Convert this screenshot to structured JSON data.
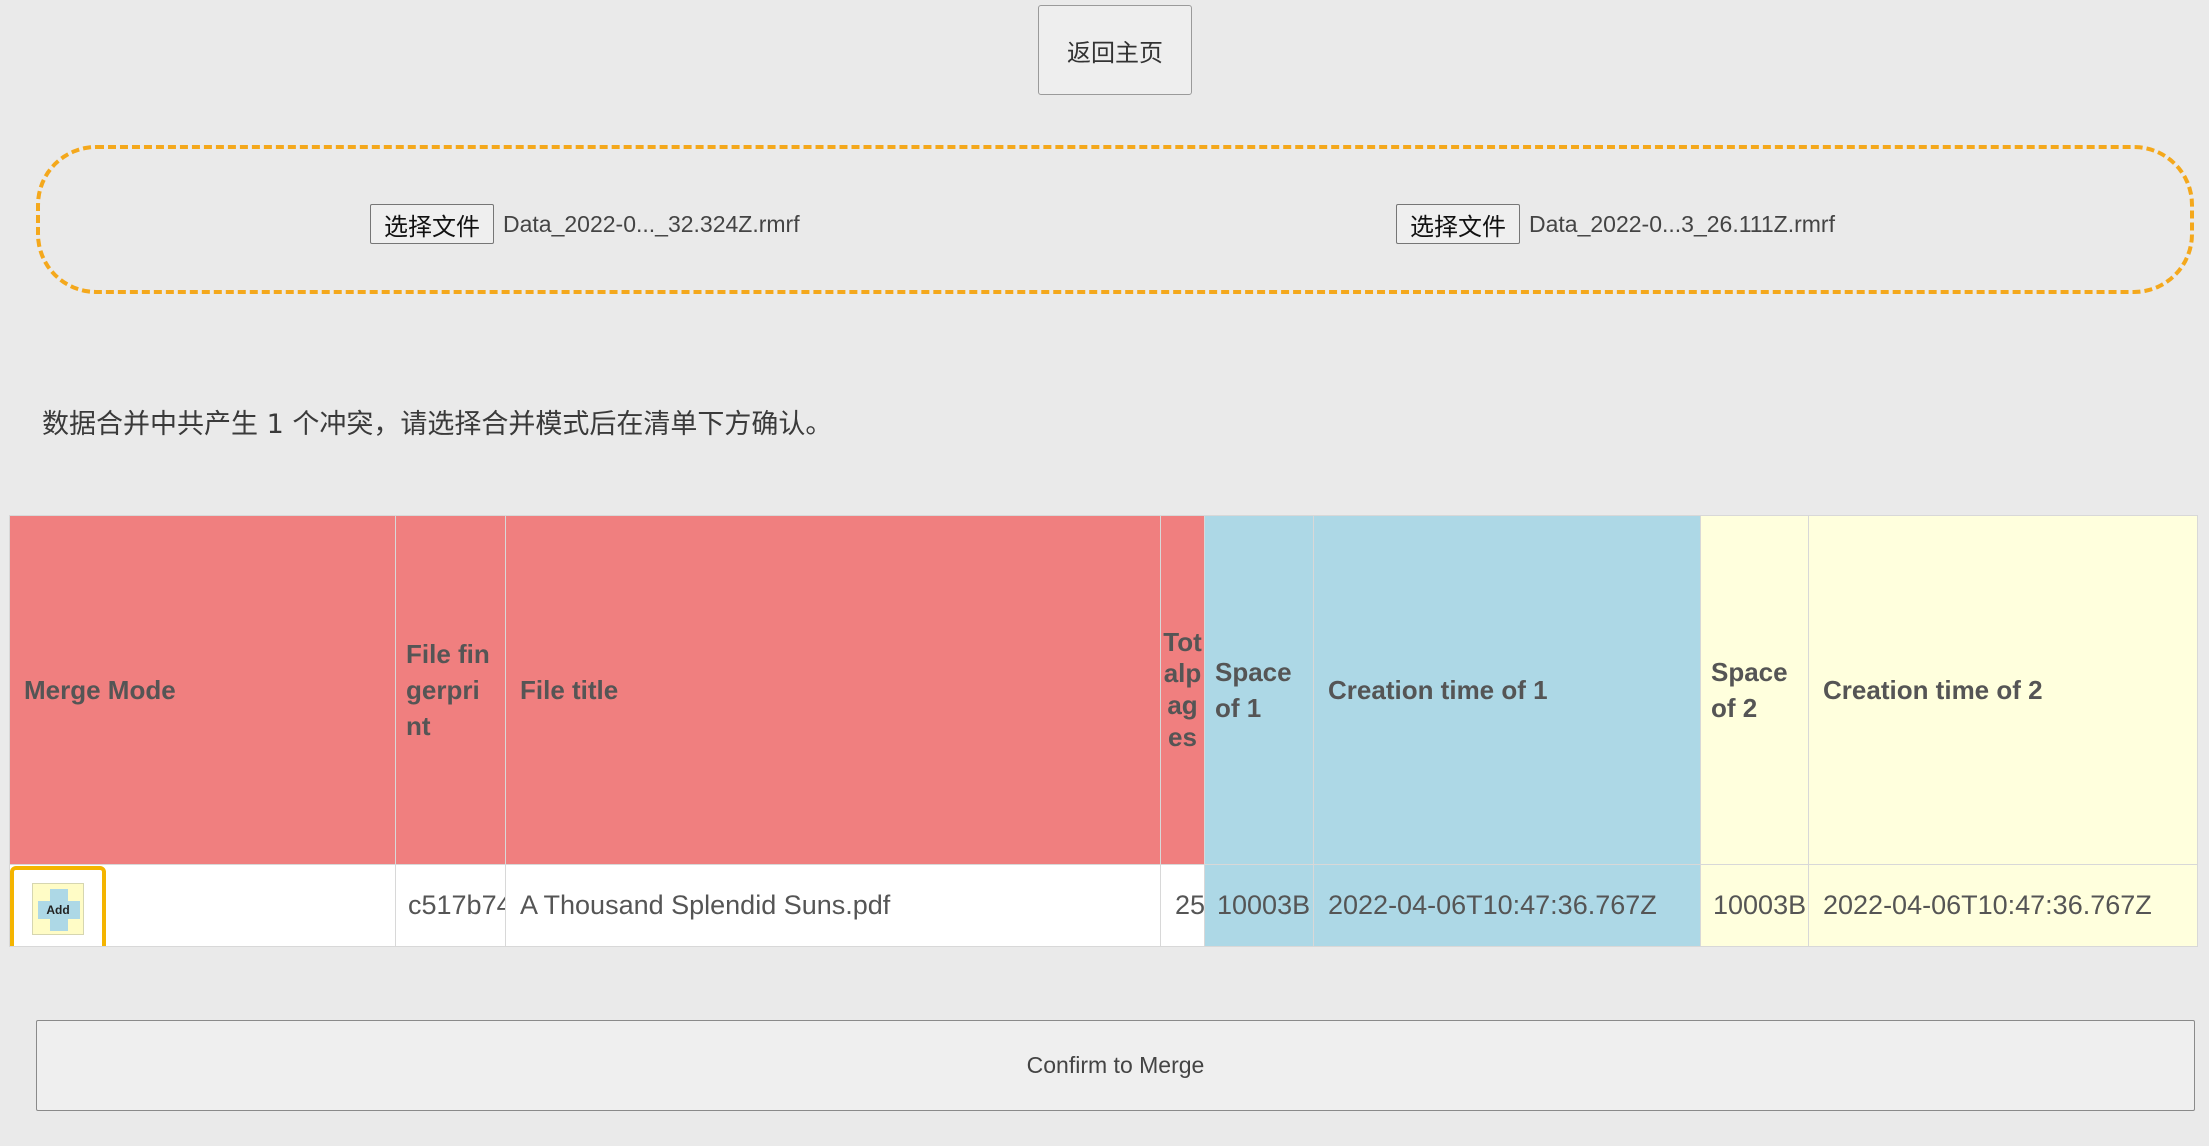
{
  "header": {
    "home_button_label": "返回主页"
  },
  "file_inputs": [
    {
      "button_label": "选择文件",
      "file_name": "Data_2022-0..._32.324Z.rmrf"
    },
    {
      "button_label": "选择文件",
      "file_name": "Data_2022-0...3_26.111Z.rmrf"
    }
  ],
  "conflict_message": "数据合并中共产生 1 个冲突，请选择合并模式后在清单下方确认。",
  "table": {
    "headers": {
      "merge_mode": "Merge Mode",
      "file_fingerprint": "File fingerprint",
      "file_title": "File title",
      "total_pages": "Totalpages",
      "space_of_1": "Space of 1",
      "creation_time_of_1": "Creation time of 1",
      "space_of_2": "Space of 2",
      "creation_time_of_2": "Creation time of 2"
    },
    "rows": [
      {
        "merge_mode": "Add",
        "file_fingerprint": "c517b74",
        "file_title": "A Thousand Splendid Suns.pdf",
        "total_pages": "25",
        "space_of_1": "10003B",
        "creation_time_of_1": "2022-04-06T10:47:36.767Z",
        "space_of_2": "10003B",
        "creation_time_of_2": "2022-04-06T10:47:36.767Z"
      }
    ]
  },
  "confirm_button_label": "Confirm to Merge",
  "colors": {
    "header_red": "#f07f7f",
    "header_blue": "#add8e6",
    "header_yellow": "#ffffdd",
    "dropzone_border": "#f4a81c",
    "selected_outline": "#f4b400"
  },
  "icons": {
    "add_mode_icon": "add-plus-icon"
  }
}
